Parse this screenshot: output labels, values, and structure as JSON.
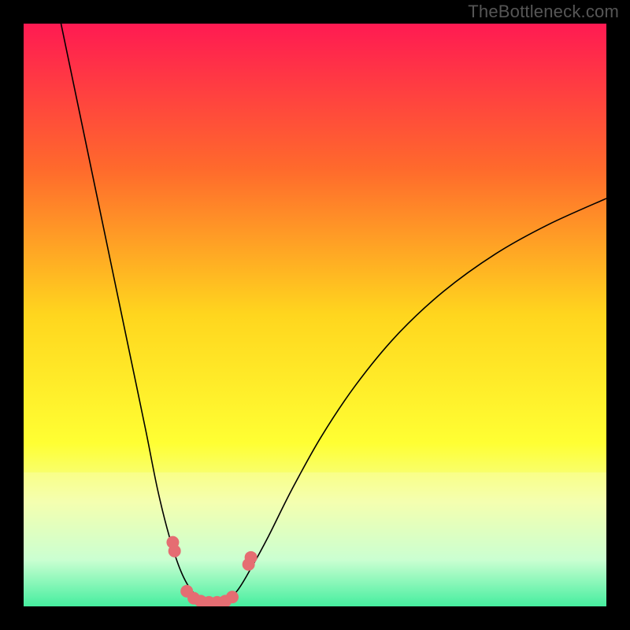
{
  "watermark": "TheBottleneck.com",
  "chart_data": {
    "type": "line",
    "title": "",
    "xlabel": "",
    "ylabel": "",
    "xlim": [
      0,
      100
    ],
    "ylim": [
      0,
      100
    ],
    "grid": false,
    "legend": false,
    "background_gradient": {
      "stops": [
        {
          "offset": 0.0,
          "color": "#ff1a52"
        },
        {
          "offset": 0.25,
          "color": "#ff6a2c"
        },
        {
          "offset": 0.5,
          "color": "#ffd61e"
        },
        {
          "offset": 0.72,
          "color": "#ffff33"
        },
        {
          "offset": 0.82,
          "color": "#f2ffa0"
        },
        {
          "offset": 0.92,
          "color": "#b8ffcf"
        },
        {
          "offset": 1.0,
          "color": "#00e88a"
        }
      ]
    },
    "band": {
      "y0": 77,
      "y1": 100,
      "color": "#faffd6",
      "opacity": 0.28
    },
    "series": [
      {
        "name": "curve",
        "kind": "smooth",
        "stroke": "#000000",
        "width": 1.6,
        "points": [
          {
            "x": 6.0,
            "y": 102.0
          },
          {
            "x": 8.5,
            "y": 90.0
          },
          {
            "x": 11.0,
            "y": 78.0
          },
          {
            "x": 13.5,
            "y": 66.0
          },
          {
            "x": 16.0,
            "y": 54.0
          },
          {
            "x": 18.5,
            "y": 42.0
          },
          {
            "x": 21.0,
            "y": 30.0
          },
          {
            "x": 23.0,
            "y": 20.0
          },
          {
            "x": 25.0,
            "y": 12.0
          },
          {
            "x": 27.0,
            "y": 6.0
          },
          {
            "x": 29.0,
            "y": 2.5
          },
          {
            "x": 31.5,
            "y": 0.8
          },
          {
            "x": 34.0,
            "y": 0.8
          },
          {
            "x": 36.5,
            "y": 2.5
          },
          {
            "x": 39.0,
            "y": 6.5
          },
          {
            "x": 42.0,
            "y": 12.0
          },
          {
            "x": 46.0,
            "y": 20.0
          },
          {
            "x": 51.0,
            "y": 29.0
          },
          {
            "x": 57.0,
            "y": 38.0
          },
          {
            "x": 64.0,
            "y": 46.5
          },
          {
            "x": 72.0,
            "y": 54.0
          },
          {
            "x": 81.0,
            "y": 60.5
          },
          {
            "x": 90.0,
            "y": 65.5
          },
          {
            "x": 100.0,
            "y": 70.0
          }
        ]
      }
    ],
    "markers": {
      "name": "highlight-dots",
      "color": "#e56d72",
      "radius": 8,
      "points": [
        {
          "x": 25.6,
          "y": 11.0
        },
        {
          "x": 25.9,
          "y": 9.5
        },
        {
          "x": 28.0,
          "y": 2.6
        },
        {
          "x": 29.2,
          "y": 1.4
        },
        {
          "x": 30.4,
          "y": 0.9
        },
        {
          "x": 31.8,
          "y": 0.7
        },
        {
          "x": 33.2,
          "y": 0.7
        },
        {
          "x": 34.6,
          "y": 0.9
        },
        {
          "x": 35.8,
          "y": 1.6
        },
        {
          "x": 38.6,
          "y": 7.2
        },
        {
          "x": 39.0,
          "y": 8.4
        }
      ]
    }
  }
}
